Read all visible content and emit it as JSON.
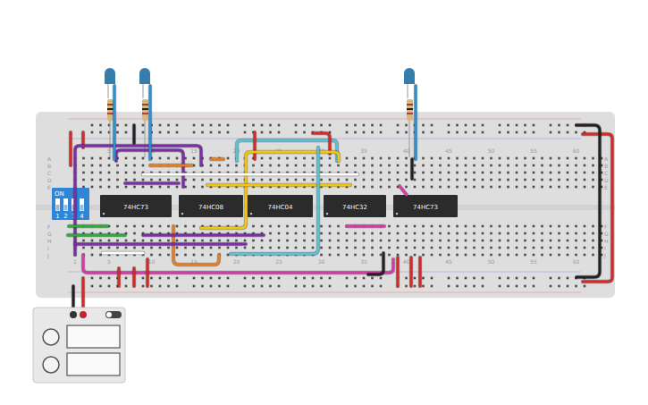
{
  "board": {
    "row_labels": [
      "A",
      "B",
      "C",
      "D",
      "E",
      "F",
      "G",
      "H",
      "I",
      "J"
    ],
    "column_labels": [
      "1",
      "5",
      "10",
      "15",
      "20",
      "25",
      "30",
      "35",
      "40",
      "45",
      "50",
      "55",
      "60"
    ]
  },
  "chips": [
    {
      "label": "74HC73"
    },
    {
      "label": "74HC08"
    },
    {
      "label": "74HC04"
    },
    {
      "label": "74HC32"
    },
    {
      "label": "74HC73"
    }
  ],
  "dip_switch": {
    "label": "ON",
    "switches": [
      {
        "label": "1",
        "on": false
      },
      {
        "label": "2",
        "on": false
      },
      {
        "label": "3",
        "on": false
      },
      {
        "label": "4",
        "on": false
      }
    ]
  },
  "leds": [
    {
      "color": "#1f6fa3",
      "on": false
    },
    {
      "color": "#1f6fa3",
      "on": false
    },
    {
      "color": "#1f6fa3",
      "on": false
    }
  ],
  "wires": [
    {
      "color": "#d42a2a"
    },
    {
      "color": "#d42a2a"
    },
    {
      "color": "#7b2fa6"
    },
    {
      "color": "#7b2fa6"
    },
    {
      "color": "#222222"
    },
    {
      "color": "#e67e22"
    },
    {
      "color": "#e67e22"
    },
    {
      "color": "#5bc0d0"
    },
    {
      "color": "#d42a2a"
    },
    {
      "color": "#d42a2a"
    },
    {
      "color": "#f1c40f"
    },
    {
      "color": "#f1c40f"
    },
    {
      "color": "#ffffff"
    },
    {
      "color": "#7b2fa6"
    },
    {
      "color": "#2eaa3e"
    },
    {
      "color": "#2eaa3e"
    },
    {
      "color": "#7b2fa6"
    },
    {
      "color": "#7b2fa6"
    },
    {
      "color": "#5bc0d0"
    },
    {
      "color": "#d63aa7"
    },
    {
      "color": "#d63aa7"
    },
    {
      "color": "#d63aa7"
    },
    {
      "color": "#222222"
    },
    {
      "color": "#d42a2a"
    },
    {
      "color": "#d42a2a"
    },
    {
      "color": "#d42a2a"
    },
    {
      "color": "#d42a2a"
    },
    {
      "color": "#d42a2a"
    },
    {
      "color": "#d42a2a"
    },
    {
      "color": "#d42a2a"
    },
    {
      "color": "#222222"
    },
    {
      "color": "#222222"
    },
    {
      "color": "#ffffff"
    },
    {
      "color": "#2f8fd0"
    },
    {
      "color": "#2f8fd0"
    },
    {
      "color": "#2f8fd0"
    },
    {
      "color": "#222222"
    },
    {
      "color": "#d42a2a"
    },
    {
      "color": "#e67e22"
    }
  ],
  "power_supply": {
    "on": false
  }
}
